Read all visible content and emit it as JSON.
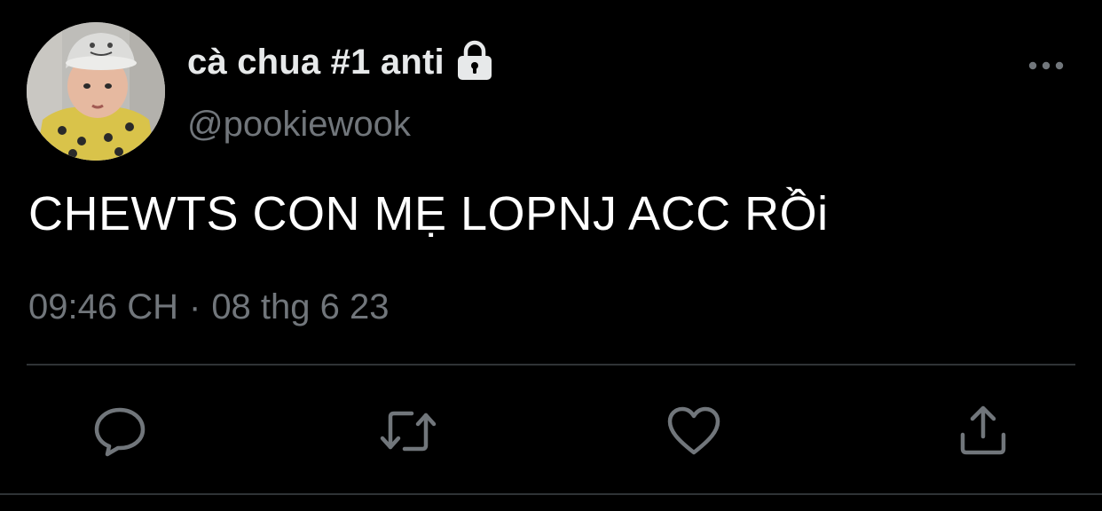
{
  "user": {
    "display_name": "cà chua #1 anti",
    "handle": "@pookiewook",
    "protected_icon": "lock-icon",
    "avatar": "avatar"
  },
  "tweet": {
    "text": "CHEWTS CON MẸ LOPNJ ACC RỒi",
    "time": "09:46 CH",
    "separator": "·",
    "date": "08 thg 6 23"
  },
  "actions": [
    {
      "name": "reply",
      "icon": "reply-icon"
    },
    {
      "name": "retweet",
      "icon": "retweet-icon"
    },
    {
      "name": "like",
      "icon": "heart-icon"
    },
    {
      "name": "share",
      "icon": "share-icon"
    }
  ],
  "colors": {
    "background": "#000000",
    "text_primary": "#e7e9ea",
    "text_secondary": "#71767b",
    "divider": "#2f3336"
  }
}
